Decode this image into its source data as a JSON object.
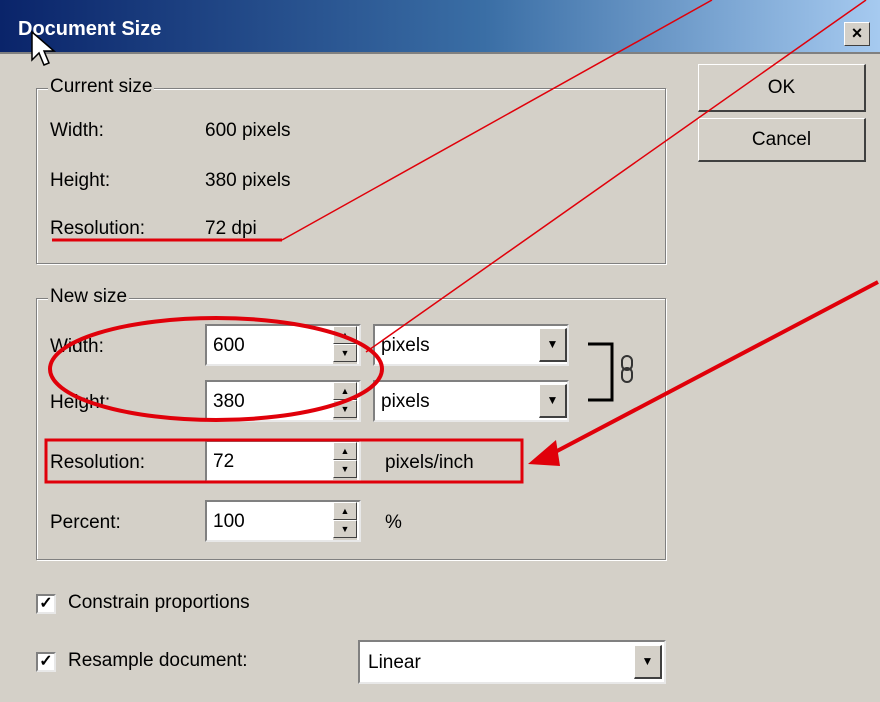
{
  "window": {
    "title": "Document Size",
    "close_glyph": "×"
  },
  "buttons": {
    "ok": "OK",
    "cancel": "Cancel"
  },
  "current_size": {
    "legend": "Current size",
    "width_label": "Width:",
    "width_value": "600 pixels",
    "height_label": "Height:",
    "height_value": "380 pixels",
    "resolution_label": "Resolution:",
    "resolution_value": "72 dpi"
  },
  "new_size": {
    "legend": "New size",
    "width_label": "Width:",
    "width_value": "600",
    "width_unit": "pixels",
    "height_label": "Height:",
    "height_value": "380",
    "height_unit": "pixels",
    "resolution_label": "Resolution:",
    "resolution_value": "72",
    "resolution_unit": "pixels/inch",
    "percent_label": "Percent:",
    "percent_value": "100",
    "percent_unit": "%"
  },
  "options": {
    "constrain_label": "Constrain proportions",
    "constrain_checked": true,
    "resample_label": "Resample document:",
    "resample_checked": true,
    "resample_method": "Linear"
  },
  "icons": [
    "mouse-pointer-icon",
    "chain-link-icon",
    "spin-up-icon",
    "spin-down-icon",
    "dropdown-arrow-icon",
    "checkmark-icon"
  ],
  "colors": {
    "titlebar": "#0a246a",
    "annotation": "#e0000a",
    "dialog_bg": "#d4d0c8"
  }
}
